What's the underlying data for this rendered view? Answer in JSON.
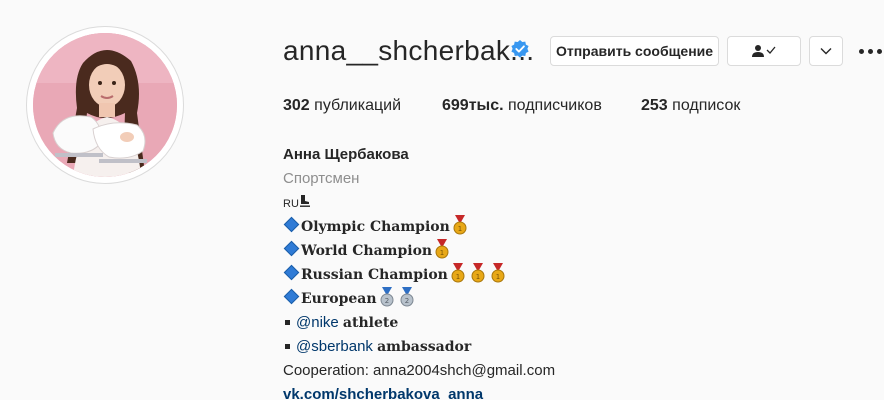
{
  "profile": {
    "username": "anna__shcherbak...",
    "verified": true,
    "avatar_bg": "#e9a8b6"
  },
  "actions": {
    "message_label": "Отправить сообщение",
    "follow_icon": "person-check-icon",
    "suggest_icon": "chevron-down-icon",
    "more_icon": "more-options-icon"
  },
  "stats": {
    "posts_count": "302",
    "posts_label": "публикаций",
    "followers_count": "699тыс.",
    "followers_label": "подписчиков",
    "following_count": "253",
    "following_label": "подписок"
  },
  "bio": {
    "full_name": "Анна Щербакова",
    "category": "Спортсмен",
    "country": "RU",
    "line_olympic": "Olympic Champion",
    "line_world": "World Champion",
    "line_russian": "Russian Champion",
    "line_european": "European",
    "nike_mention": "@nike",
    "nike_rest": "athlete",
    "sber_mention": "@sberbank",
    "sber_rest": "ambassador",
    "cooperation": "Cooperation: anna2004shch@gmail.com",
    "website": "vk.com/shcherbakova_anna"
  },
  "colors": {
    "verified_blue": "#3897f0",
    "link": "#00376b",
    "gold_medal": "#e8a817",
    "silver_medal": "#b8c2cc",
    "ribbon": "#c62828"
  }
}
